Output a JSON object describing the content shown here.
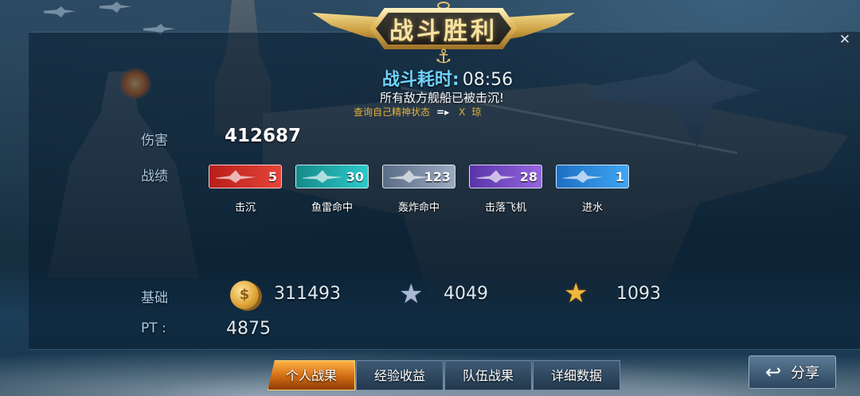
{
  "banner": {
    "title": "战斗胜利"
  },
  "battle": {
    "duration_label": "战斗耗时:",
    "duration_value": "08:56",
    "result_message": "所有敌方舰船已被击沉!",
    "spirit_link": "查询自己精神状态",
    "spirit_link_arrow": "=▸",
    "spirit_link_suffix_x": "X",
    "spirit_link_suffix_char": "琼"
  },
  "damage": {
    "label": "伤害",
    "value": "412687"
  },
  "record": {
    "label": "战绩",
    "items": [
      {
        "label": "击沉",
        "count": "5",
        "color": "#e0362a",
        "icon": "ship-sink-icon"
      },
      {
        "label": "鱼雷命中",
        "count": "30",
        "color": "#1fb3b3",
        "icon": "torpedo-icon"
      },
      {
        "label": "轰炸命中",
        "count": "123",
        "color": "#7a8ea8",
        "icon": "bomb-icon"
      },
      {
        "label": "击落飞机",
        "count": "28",
        "color": "#7a4fc4",
        "icon": "plane-down-icon"
      },
      {
        "label": "进水",
        "count": "1",
        "color": "#2f8fe0",
        "icon": "flooding-icon"
      }
    ]
  },
  "base": {
    "label": "基础",
    "gold": "311493",
    "silver_star": "4049",
    "gold_star": "1093"
  },
  "pt": {
    "label": "PT :",
    "value": "4875"
  },
  "tabs": [
    {
      "label": "个人战果",
      "active": true
    },
    {
      "label": "经验收益",
      "active": false
    },
    {
      "label": "队伍战果",
      "active": false
    },
    {
      "label": "详细数据",
      "active": false
    }
  ],
  "share": {
    "label": "分享",
    "icon": "return-arrow-icon"
  },
  "close": {
    "glyph": "✕"
  }
}
